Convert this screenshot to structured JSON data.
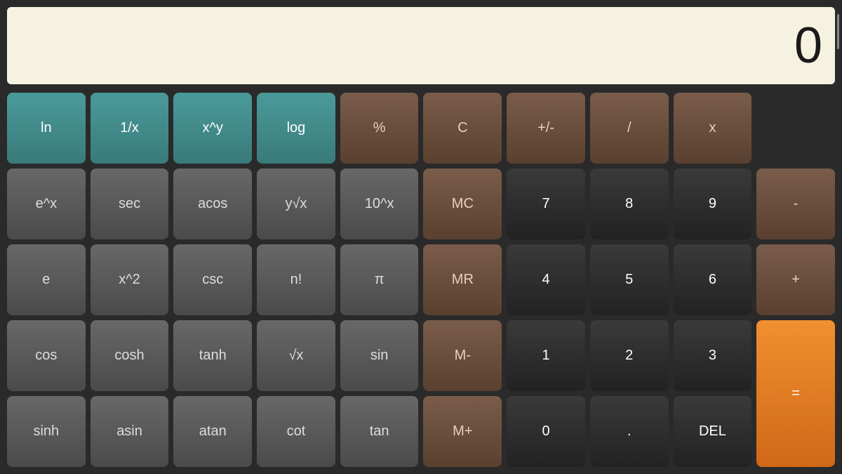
{
  "display": {
    "value": "0"
  },
  "buttons": {
    "row1": [
      {
        "label": "ln",
        "type": "teal",
        "name": "btn-ln"
      },
      {
        "label": "1/x",
        "type": "teal",
        "name": "btn-reciprocal"
      },
      {
        "label": "x^y",
        "type": "teal",
        "name": "btn-xpowy"
      },
      {
        "label": "log",
        "type": "teal",
        "name": "btn-log"
      },
      {
        "label": "%",
        "type": "brown",
        "name": "btn-percent"
      },
      {
        "label": "C",
        "type": "brown",
        "name": "btn-clear"
      },
      {
        "label": "+/-",
        "type": "brown",
        "name": "btn-plusminus"
      },
      {
        "label": "/",
        "type": "brown",
        "name": "btn-divide"
      },
      {
        "label": "x",
        "type": "brown",
        "name": "btn-multiply"
      }
    ],
    "row2": [
      {
        "label": "e^x",
        "type": "gray",
        "name": "btn-ex"
      },
      {
        "label": "sec",
        "type": "gray",
        "name": "btn-sec"
      },
      {
        "label": "acos",
        "type": "gray",
        "name": "btn-acos"
      },
      {
        "label": "y√x",
        "type": "gray",
        "name": "btn-yrootx"
      },
      {
        "label": "10^x",
        "type": "gray",
        "name": "btn-10x"
      },
      {
        "label": "MC",
        "type": "memory",
        "name": "btn-mc"
      },
      {
        "label": "7",
        "type": "dark",
        "name": "btn-7"
      },
      {
        "label": "8",
        "type": "dark",
        "name": "btn-8"
      },
      {
        "label": "9",
        "type": "dark",
        "name": "btn-9"
      },
      {
        "label": "-",
        "type": "brown",
        "name": "btn-subtract"
      }
    ],
    "row3": [
      {
        "label": "e",
        "type": "gray",
        "name": "btn-e"
      },
      {
        "label": "x^2",
        "type": "gray",
        "name": "btn-xsquared"
      },
      {
        "label": "csc",
        "type": "gray",
        "name": "btn-csc"
      },
      {
        "label": "n!",
        "type": "gray",
        "name": "btn-factorial"
      },
      {
        "label": "π",
        "type": "gray",
        "name": "btn-pi"
      },
      {
        "label": "MR",
        "type": "memory",
        "name": "btn-mr"
      },
      {
        "label": "4",
        "type": "dark",
        "name": "btn-4"
      },
      {
        "label": "5",
        "type": "dark",
        "name": "btn-5"
      },
      {
        "label": "6",
        "type": "dark",
        "name": "btn-6"
      },
      {
        "label": "+",
        "type": "brown",
        "name": "btn-add"
      }
    ],
    "row4": [
      {
        "label": "cos",
        "type": "gray",
        "name": "btn-cos"
      },
      {
        "label": "cosh",
        "type": "gray",
        "name": "btn-cosh"
      },
      {
        "label": "tanh",
        "type": "gray",
        "name": "btn-tanh"
      },
      {
        "label": "√x",
        "type": "gray",
        "name": "btn-sqrt"
      },
      {
        "label": "sin",
        "type": "gray",
        "name": "btn-sin"
      },
      {
        "label": "M-",
        "type": "memory",
        "name": "btn-mminus"
      },
      {
        "label": "1",
        "type": "dark",
        "name": "btn-1"
      },
      {
        "label": "2",
        "type": "dark",
        "name": "btn-2"
      },
      {
        "label": "3",
        "type": "dark",
        "name": "btn-3"
      },
      {
        "label": "=",
        "type": "orange",
        "name": "btn-equals"
      }
    ],
    "row5": [
      {
        "label": "sinh",
        "type": "gray",
        "name": "btn-sinh"
      },
      {
        "label": "asin",
        "type": "gray",
        "name": "btn-asin"
      },
      {
        "label": "atan",
        "type": "gray",
        "name": "btn-atan"
      },
      {
        "label": "cot",
        "type": "gray",
        "name": "btn-cot"
      },
      {
        "label": "tan",
        "type": "gray",
        "name": "btn-tan"
      },
      {
        "label": "M+",
        "type": "memory",
        "name": "btn-mplus"
      },
      {
        "label": "0",
        "type": "dark",
        "name": "btn-0"
      },
      {
        "label": ".",
        "type": "dark",
        "name": "btn-decimal"
      },
      {
        "label": "DEL",
        "type": "dark",
        "name": "btn-del"
      }
    ]
  }
}
